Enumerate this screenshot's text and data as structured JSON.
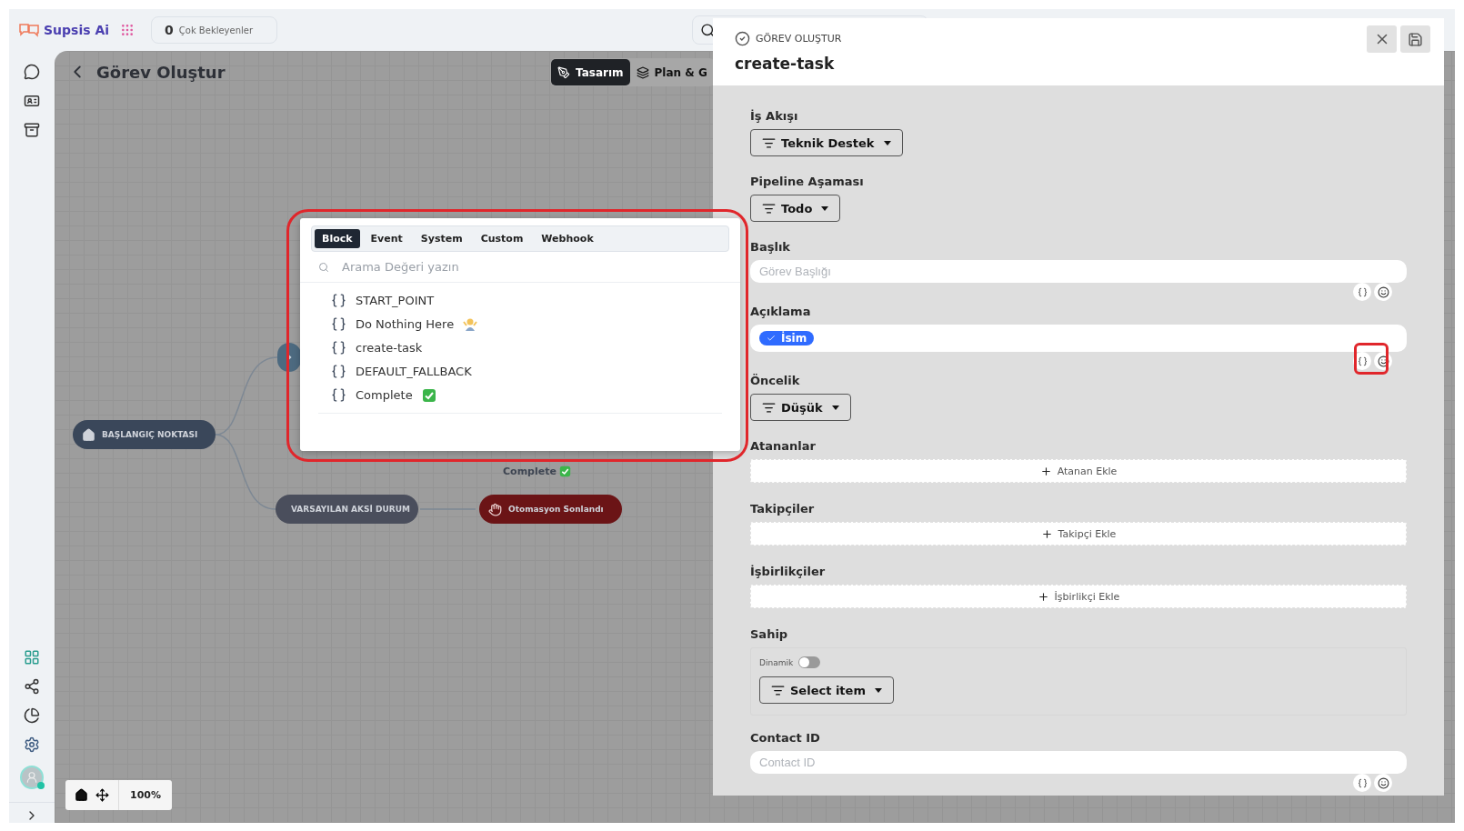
{
  "topbar": {
    "brand": "Supsis Ai",
    "waiting": {
      "count": "0",
      "label": "Çok Bekleyenler"
    }
  },
  "page": {
    "title": "Görev Oluştur",
    "view_tabs": [
      {
        "label": "Tasarım",
        "selected": true
      },
      {
        "label": "Plan & G",
        "selected": false
      }
    ]
  },
  "canvas": {
    "nodes": [
      {
        "kind": "start",
        "label": "BAŞLANGIÇ NOKTASI"
      },
      {
        "kind": "condition"
      },
      {
        "kind": "fallback",
        "label": "VARSAYILAN AKSİ DURUM"
      },
      {
        "kind": "end",
        "label": "Otomasyon Sonlandı"
      }
    ],
    "edge_label": {
      "text": "Complete",
      "kind": "check"
    },
    "zoom": "100%"
  },
  "variable_picker": {
    "tabs": [
      {
        "label": "Block",
        "selected": true
      },
      {
        "label": "Event",
        "selected": false
      },
      {
        "label": "System",
        "selected": false
      },
      {
        "label": "Custom",
        "selected": false
      },
      {
        "label": "Webhook",
        "selected": false
      }
    ],
    "search": {
      "placeholder": "Arama Değeri yazın"
    },
    "items": [
      {
        "text": "START_POINT",
        "kind": "plain"
      },
      {
        "text": "Do Nothing Here",
        "kind": "shrug"
      },
      {
        "text": "create-task",
        "kind": "plain"
      },
      {
        "text": "DEFAULT_FALLBACK",
        "kind": "plain"
      },
      {
        "text": "Complete",
        "kind": "check"
      }
    ]
  },
  "drawer": {
    "kicker": "GÖREV OLUŞTUR",
    "title": "create-task",
    "fields": [
      {
        "kind": "select",
        "label": "İş Akışı",
        "value": "Teknik Destek"
      },
      {
        "kind": "select",
        "label": "Pipeline Aşaması",
        "value": "Todo"
      },
      {
        "kind": "text",
        "label": "Başlık",
        "placeholder": "Görev Başlığı"
      },
      {
        "kind": "chips",
        "label": "Açıklama",
        "chips": [
          "İsim"
        ]
      },
      {
        "kind": "select",
        "label": "Öncelik",
        "value": "Düşük"
      },
      {
        "kind": "add",
        "label": "Atananlar",
        "action": "Atanan Ekle"
      },
      {
        "kind": "add",
        "label": "Takipçiler",
        "action": "Takipçi Ekle"
      },
      {
        "kind": "add",
        "label": "İşbirlikçiler",
        "action": "İşbirlikçi Ekle"
      },
      {
        "kind": "owner",
        "label": "Sahip",
        "toggle": {
          "label": "Dinamik",
          "on": false
        },
        "value": "Select item"
      },
      {
        "kind": "text",
        "label": "Contact ID",
        "placeholder": "Contact ID"
      }
    ]
  }
}
